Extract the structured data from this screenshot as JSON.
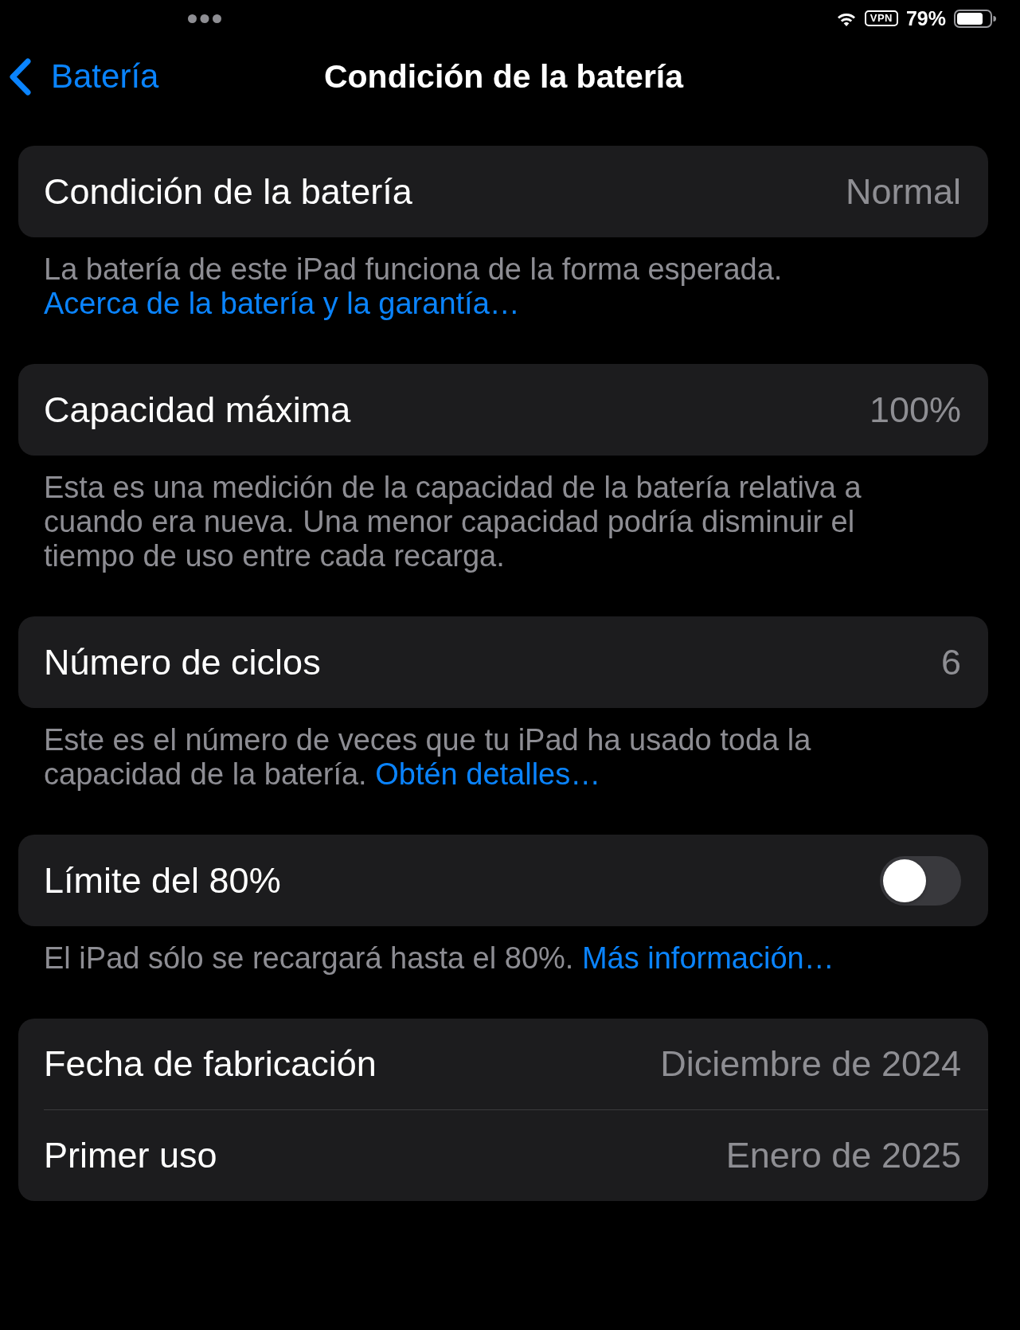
{
  "status_bar": {
    "vpn": "VPN",
    "battery_percent": "79%"
  },
  "nav_bar": {
    "back_label": "Batería",
    "title": "Condición de la batería"
  },
  "sections": [
    {
      "rows": [
        {
          "kind": "value",
          "label": "Condición de la batería",
          "value": "Normal"
        }
      ],
      "footer": {
        "text": "La batería de este iPad funciona de la forma esperada.",
        "link": "Acerca de la batería y la garantía…"
      }
    },
    {
      "rows": [
        {
          "kind": "value",
          "label": "Capacidad máxima",
          "value": "100%"
        }
      ],
      "footer": {
        "text": "Esta es una medición de la capacidad de la batería relativa a cuando era nueva. Una menor capacidad podría disminuir el tiempo de uso entre cada recarga."
      }
    },
    {
      "rows": [
        {
          "kind": "value",
          "label": "Número de ciclos",
          "value": "6"
        }
      ],
      "footer": {
        "text": "Este es el número de veces que tu iPad ha usado toda la capacidad de la batería.",
        "link": "Obtén detalles…"
      }
    },
    {
      "rows": [
        {
          "kind": "toggle",
          "label": "Límite del 80%",
          "on": false
        }
      ],
      "footer": {
        "text": "El iPad sólo se recargará hasta el 80%.",
        "link": "Más información…"
      }
    },
    {
      "rows": [
        {
          "kind": "value",
          "label": "Fecha de fabricación",
          "value": "Diciembre de 2024"
        },
        {
          "kind": "value",
          "label": "Primer uso",
          "value": "Enero de 2025"
        }
      ]
    }
  ]
}
